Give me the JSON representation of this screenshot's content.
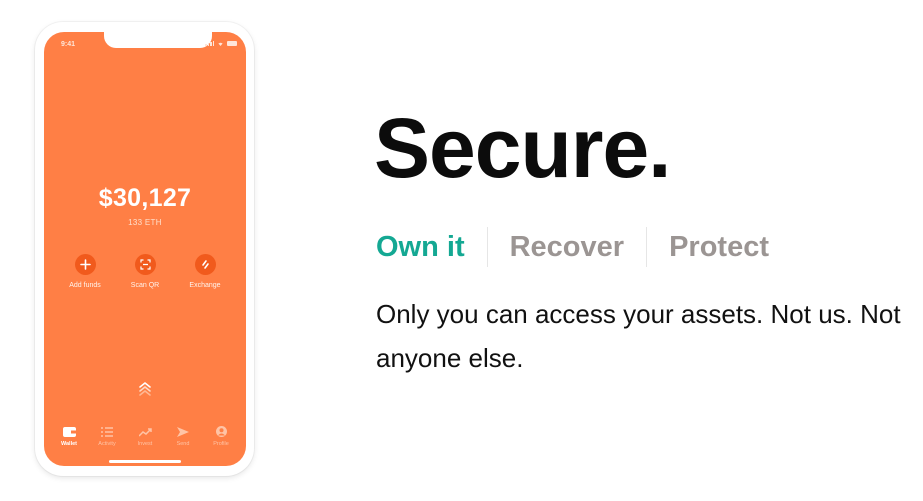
{
  "phone": {
    "status_time": "9:41",
    "balance": "$30,127",
    "balance_sub": "133 ETH",
    "actions": [
      {
        "label": "Add funds",
        "icon": "plus-icon"
      },
      {
        "label": "Scan QR",
        "icon": "scan-qr-icon"
      },
      {
        "label": "Exchange",
        "icon": "exchange-icon"
      }
    ],
    "tabs": [
      {
        "label": "Wallet",
        "icon": "wallet-icon",
        "active": true
      },
      {
        "label": "Activity",
        "icon": "list-icon",
        "active": false
      },
      {
        "label": "Invest",
        "icon": "trend-up-icon",
        "active": false
      },
      {
        "label": "Send",
        "icon": "send-icon",
        "active": false
      },
      {
        "label": "Profile",
        "icon": "profile-icon",
        "active": false
      }
    ],
    "colors": {
      "screen": "#ff7f45",
      "action_circle": "#f15a1c"
    }
  },
  "headline": "Secure.",
  "feature_tabs": [
    {
      "label": "Own it",
      "active": true
    },
    {
      "label": "Recover",
      "active": false
    },
    {
      "label": "Protect",
      "active": false
    }
  ],
  "description": "Only you can access your assets. Not us. Not anyone else.",
  "colors": {
    "accent": "#14a893",
    "inactive_tab": "#9b9593",
    "headline": "#0c0c0c"
  }
}
